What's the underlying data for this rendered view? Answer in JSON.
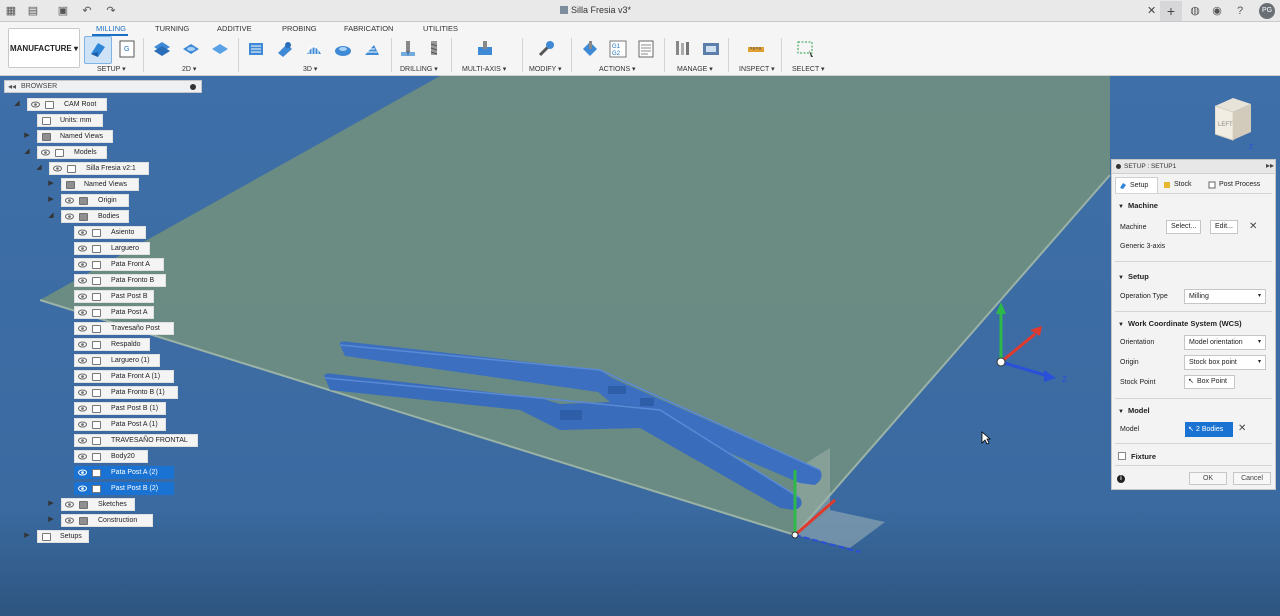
{
  "titlebar": {
    "document_title": "Silla Fresia v3*",
    "user_initials": "PG",
    "close_glyph": "✕",
    "new_tab_glyph": "+"
  },
  "ribbon": {
    "workspace_label": "MANUFACTURE ▾",
    "tabs": [
      "MILLING",
      "TURNING",
      "ADDITIVE",
      "PROBING",
      "FABRICATION",
      "UTILITIES"
    ],
    "groups": [
      "SETUP ▾",
      "2D ▾",
      "3D ▾",
      "DRILLING ▾",
      "MULTI-AXIS ▾",
      "MODIFY ▾",
      "ACTIONS ▾",
      "MANAGE ▾",
      "INSPECT ▾",
      "SELECT ▾"
    ],
    "g1g2_label": "G1\nG2"
  },
  "browser": {
    "title": "BROWSER",
    "rows": [
      {
        "label": "CAM Root"
      },
      {
        "label": "Units: mm"
      },
      {
        "label": "Named Views"
      },
      {
        "label": "Models"
      },
      {
        "label": "Silla Fresia v2:1"
      },
      {
        "label": "Named Views"
      },
      {
        "label": "Origin"
      },
      {
        "label": "Bodies"
      },
      {
        "label": "Asiento"
      },
      {
        "label": "Larguero"
      },
      {
        "label": "Pata Front A"
      },
      {
        "label": "Pata Fronto B"
      },
      {
        "label": "Past Post B"
      },
      {
        "label": "Pata Post A"
      },
      {
        "label": "Travesaño Post"
      },
      {
        "label": "Respaldo"
      },
      {
        "label": "Larguero (1)"
      },
      {
        "label": "Pata Front A (1)"
      },
      {
        "label": "Pata Fronto B (1)"
      },
      {
        "label": "Past Post B (1)"
      },
      {
        "label": "Pata Post A (1)"
      },
      {
        "label": "TRAVESAÑO FRONTAL"
      },
      {
        "label": "Body20"
      },
      {
        "label": "Pata Post A (2)"
      },
      {
        "label": "Past Post B (2)"
      },
      {
        "label": "Sketches"
      },
      {
        "label": "Construction"
      },
      {
        "label": "Setups"
      }
    ]
  },
  "viewcube": {
    "face_label": "LEFT",
    "axis_label": "Z"
  },
  "triad": {
    "z_label": "Z"
  },
  "setup_dialog": {
    "title": "SETUP : SETUP1",
    "tabs": [
      "Setup",
      "Stock",
      "Post Process"
    ],
    "machine": {
      "section": "Machine",
      "label": "Machine",
      "select_button": "Select...",
      "edit_button": "Edit...",
      "machine_name": "Generic 3-axis"
    },
    "setup": {
      "section": "Setup",
      "operation_type_label": "Operation Type",
      "operation_type_value": "Milling"
    },
    "wcs": {
      "section": "Work Coordinate System (WCS)",
      "orientation_label": "Orientation",
      "orientation_value": "Model orientation",
      "origin_label": "Origin",
      "origin_value": "Stock box point",
      "stock_point_label": "Stock Point",
      "stock_point_value": "Box Point"
    },
    "model": {
      "section": "Model",
      "label": "Model",
      "value": "2 Bodies"
    },
    "fixture": {
      "section": "Fixture"
    },
    "ok_button": "OK",
    "cancel_button": "Cancel",
    "info_glyph": "i"
  },
  "colors": {
    "accent": "#1a73d2",
    "viewport_bg": "#3f6fa6",
    "stock_plane": "#6f8f7f",
    "part_body": "#3c6fc0"
  }
}
